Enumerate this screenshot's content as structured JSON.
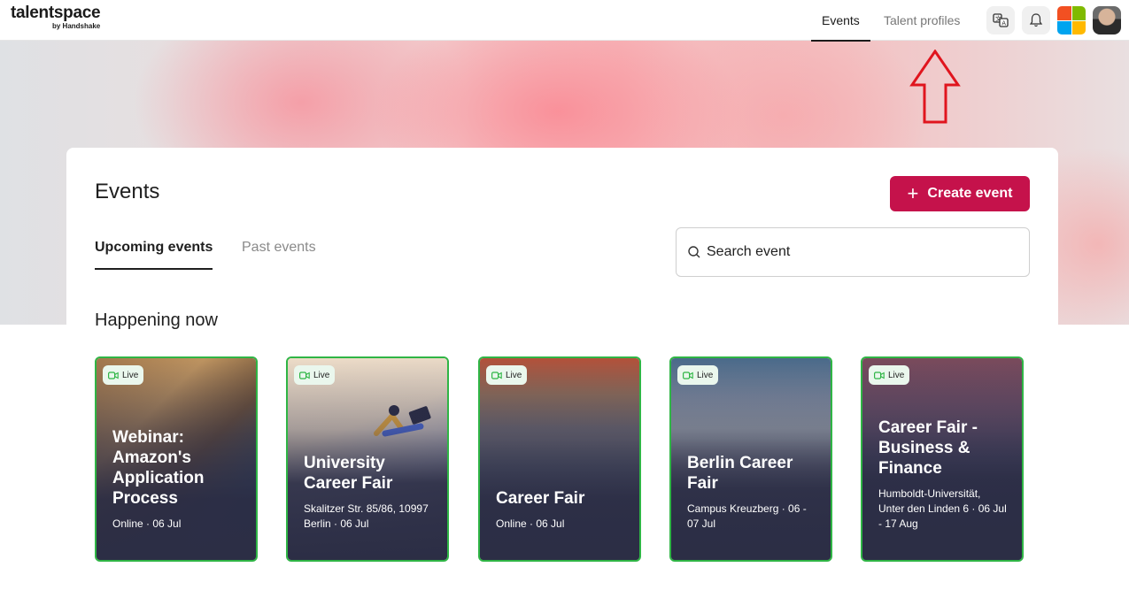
{
  "header": {
    "logo_main": "talentspace",
    "logo_sub": "by Handshake",
    "nav": [
      {
        "label": "Events"
      },
      {
        "label": "Talent profiles"
      }
    ]
  },
  "page": {
    "title": "Events",
    "create_label": "Create event",
    "tabs": [
      {
        "label": "Upcoming events"
      },
      {
        "label": "Past events"
      }
    ],
    "search_placeholder": "Search event",
    "section_title": "Happening now"
  },
  "events": [
    {
      "badge": "Live",
      "title": "Webinar: Amazon's Application Process",
      "meta": "Online · 06 Jul"
    },
    {
      "badge": "Live",
      "title": "University Career Fair",
      "meta": "Skalitzer Str. 85/86, 10997 Berlin · 06 Jul"
    },
    {
      "badge": "Live",
      "title": "Career Fair",
      "meta": "Online · 06 Jul"
    },
    {
      "badge": "Live",
      "title": "Berlin Career Fair",
      "meta": "Campus Kreuzberg · 06 - 07 Jul"
    },
    {
      "badge": "Live",
      "title": "Career Fair - Business & Finance",
      "meta": "Humboldt-Universität, Unter den Linden 6 · 06 Jul - 17 Aug"
    }
  ],
  "colors": {
    "accent": "#c5124b",
    "live_border": "#2fb545",
    "annotation": "#e0151e"
  }
}
